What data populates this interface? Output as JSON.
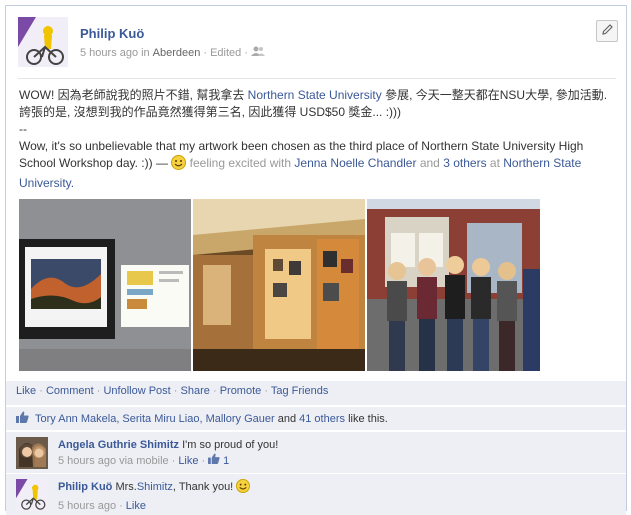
{
  "post": {
    "author": "Philip Kuö",
    "time": "5 hours ago",
    "location_prefix": "in",
    "location": "Aberdeen",
    "edited": "Edited",
    "text_zh_1": "WOW! 因為老師說我的照片不錯, 幫我拿去",
    "text_zh_link": "Northern State University",
    "text_zh_2": "參展, 今天一整天都在NSU大學, 參加活動. 誇張的是, 沒想到我的作品竟然獲得第三名, 因此獲得 USD$50 獎金... :)))",
    "separator": "--",
    "text_en": "Wow, it's so unbelievable that my artwork been chosen as the third place of Northern State University High School Workshop day. :)) —",
    "feeling": "feeling excited",
    "with": "with",
    "tagged_person": "Jenna Noelle Chandler",
    "and": "and",
    "others": "3 others",
    "at": "at",
    "place": "Northern State University."
  },
  "actions": {
    "like": "Like",
    "comment": "Comment",
    "unfollow": "Unfollow Post",
    "share": "Share",
    "promote": "Promote",
    "tag_friends": "Tag Friends",
    "dot": "·"
  },
  "likes": {
    "names": "Tory Ann Makela, Serita Miru Liao, Mallory Gauer",
    "and": "and",
    "others": "41 others",
    "suffix": "like this."
  },
  "comments": [
    {
      "name": "Angela Guthrie Shimitz",
      "text": "I'm so proud of you!",
      "time": "5 hours ago",
      "via": "via mobile",
      "like": "Like",
      "like_count": "1"
    },
    {
      "name": "Philip Kuö",
      "text_prefix": "Mrs.",
      "text_link": "Shimitz",
      "text_suffix": ", Thank you!",
      "time": "5 hours ago",
      "like": "Like"
    }
  ],
  "colors": {
    "link": "#3b5998",
    "panel": "#edeff4",
    "border": "#c4cde0"
  },
  "icons": {
    "edit": "pencil-icon",
    "audience": "friends-icon",
    "like": "thumbs-up-icon",
    "feeling": "smiley-icon"
  }
}
